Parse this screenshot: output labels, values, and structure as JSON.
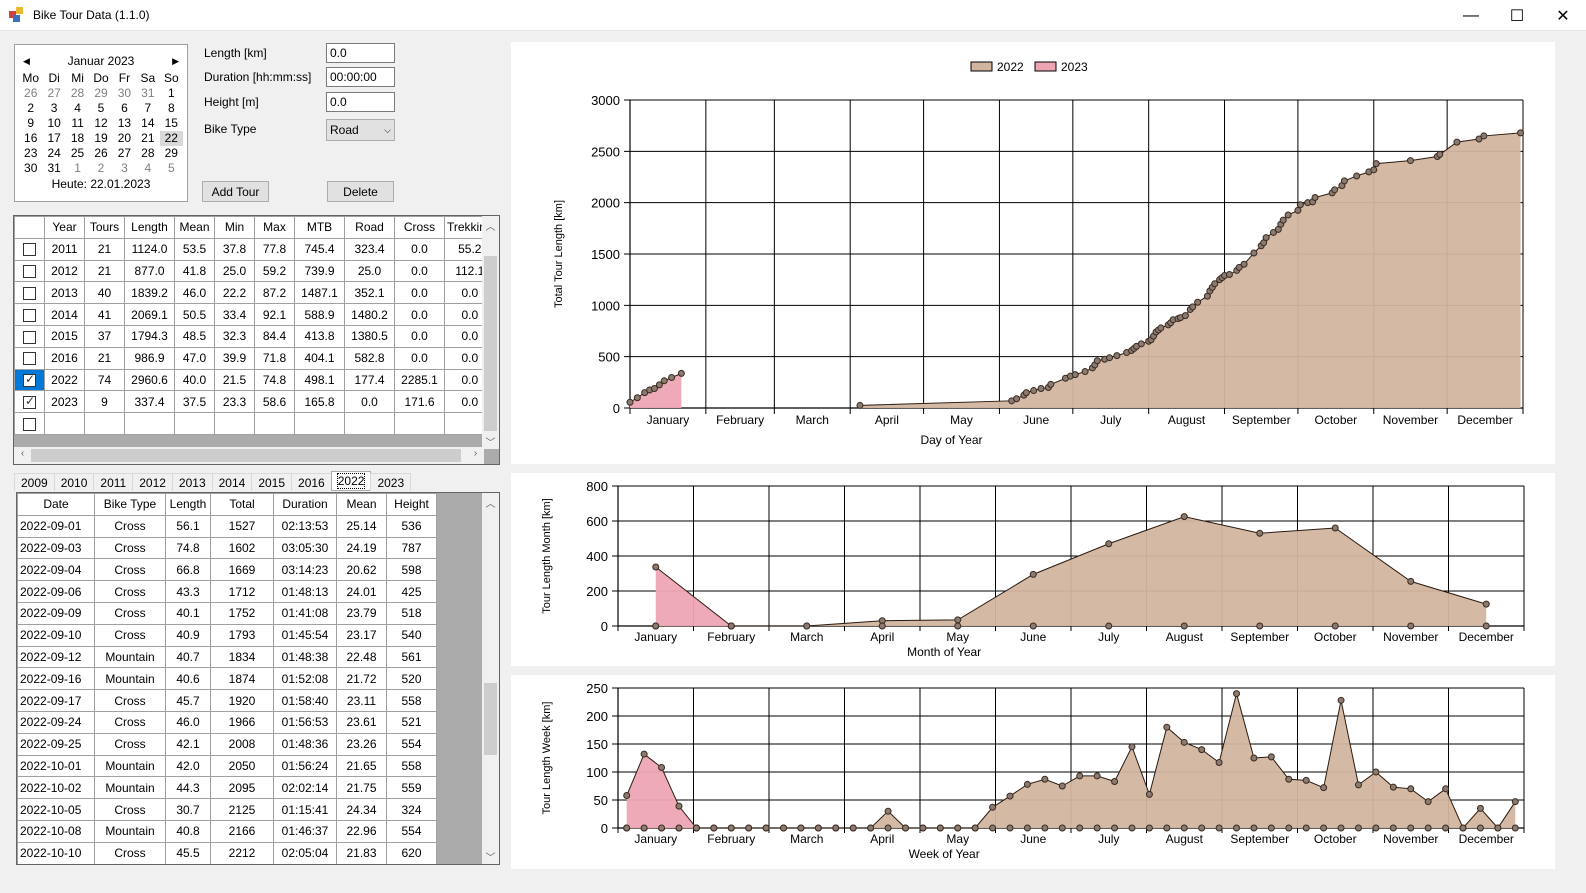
{
  "window": {
    "title": "Bike Tour Data (1.1.0)",
    "controls": {
      "minimize": "—",
      "maximize": "☐",
      "close": "✕"
    }
  },
  "calendar": {
    "month_label": "Januar 2023",
    "prev_arrow": "◀",
    "next_arrow": "▶",
    "weekdays": [
      "Mo",
      "Di",
      "Mi",
      "Do",
      "Fr",
      "Sa",
      "So"
    ],
    "weeks": [
      [
        {
          "d": "26",
          "dim": true
        },
        {
          "d": "27",
          "dim": true
        },
        {
          "d": "28",
          "dim": true
        },
        {
          "d": "29",
          "dim": true
        },
        {
          "d": "30",
          "dim": true
        },
        {
          "d": "31",
          "dim": true
        },
        {
          "d": "1"
        }
      ],
      [
        {
          "d": "2"
        },
        {
          "d": "3"
        },
        {
          "d": "4"
        },
        {
          "d": "5"
        },
        {
          "d": "6"
        },
        {
          "d": "7"
        },
        {
          "d": "8"
        }
      ],
      [
        {
          "d": "9"
        },
        {
          "d": "10"
        },
        {
          "d": "11"
        },
        {
          "d": "12"
        },
        {
          "d": "13"
        },
        {
          "d": "14"
        },
        {
          "d": "15"
        }
      ],
      [
        {
          "d": "16"
        },
        {
          "d": "17"
        },
        {
          "d": "18"
        },
        {
          "d": "19"
        },
        {
          "d": "20"
        },
        {
          "d": "21"
        },
        {
          "d": "22",
          "selected": true
        }
      ],
      [
        {
          "d": "23"
        },
        {
          "d": "24"
        },
        {
          "d": "25"
        },
        {
          "d": "26"
        },
        {
          "d": "27"
        },
        {
          "d": "28"
        },
        {
          "d": "29"
        }
      ],
      [
        {
          "d": "30"
        },
        {
          "d": "31"
        },
        {
          "d": "1",
          "dim": true
        },
        {
          "d": "2",
          "dim": true
        },
        {
          "d": "3",
          "dim": true
        },
        {
          "d": "4",
          "dim": true
        },
        {
          "d": "5",
          "dim": true
        }
      ]
    ],
    "today_label": "Heute: 22.01.2023"
  },
  "form": {
    "length_label": "Length [km]",
    "length_value": "0.0",
    "duration_label": "Duration [hh:mm:ss]",
    "duration_value": "00:00:00",
    "height_label": "Height [m]",
    "height_value": "0.0",
    "bike_type_label": "Bike Type",
    "bike_type_value": "Road",
    "add_tour_button": "Add Tour",
    "delete_button": "Delete"
  },
  "year_summary": {
    "columns": [
      "",
      "Year",
      "Tours",
      "Length",
      "Mean",
      "Min",
      "Max",
      "MTB",
      "Road",
      "Cross",
      "Trekking"
    ],
    "rows": [
      {
        "checked": false,
        "cells": [
          "2011",
          "21",
          "1124.0",
          "53.5",
          "37.8",
          "77.8",
          "745.4",
          "323.4",
          "0.0",
          "55.2"
        ]
      },
      {
        "checked": false,
        "cells": [
          "2012",
          "21",
          "877.0",
          "41.8",
          "25.0",
          "59.2",
          "739.9",
          "25.0",
          "0.0",
          "112.1"
        ]
      },
      {
        "checked": false,
        "cells": [
          "2013",
          "40",
          "1839.2",
          "46.0",
          "22.2",
          "87.2",
          "1487.1",
          "352.1",
          "0.0",
          "0.0"
        ]
      },
      {
        "checked": false,
        "cells": [
          "2014",
          "41",
          "2069.1",
          "50.5",
          "33.4",
          "92.1",
          "588.9",
          "1480.2",
          "0.0",
          "0.0"
        ]
      },
      {
        "checked": false,
        "cells": [
          "2015",
          "37",
          "1794.3",
          "48.5",
          "32.3",
          "84.4",
          "413.8",
          "1380.5",
          "0.0",
          "0.0"
        ]
      },
      {
        "checked": false,
        "cells": [
          "2016",
          "21",
          "986.9",
          "47.0",
          "39.9",
          "71.8",
          "404.1",
          "582.8",
          "0.0",
          "0.0"
        ]
      },
      {
        "checked": true,
        "active": true,
        "cells": [
          "2022",
          "74",
          "2960.6",
          "40.0",
          "21.5",
          "74.8",
          "498.1",
          "177.4",
          "2285.1",
          "0.0"
        ]
      },
      {
        "checked": true,
        "cells": [
          "2023",
          "9",
          "337.4",
          "37.5",
          "23.3",
          "58.6",
          "165.8",
          "0.0",
          "171.6",
          "0.0"
        ]
      },
      {
        "checked": false,
        "cells": [
          "",
          "",
          "",
          "",
          "",
          "",
          "",
          "",
          "",
          ""
        ]
      }
    ]
  },
  "year_tabs": {
    "tabs": [
      "2009",
      "2010",
      "2011",
      "2012",
      "2013",
      "2014",
      "2015",
      "2016",
      "2022",
      "2023"
    ],
    "active": "2022"
  },
  "tours": {
    "columns": [
      "Date",
      "Bike Type",
      "Length",
      "Total",
      "Duration",
      "Mean",
      "Height"
    ],
    "rows": [
      [
        "2022-09-01",
        "Cross",
        "56.1",
        "1527",
        "02:13:53",
        "25.14",
        "536"
      ],
      [
        "2022-09-03",
        "Cross",
        "74.8",
        "1602",
        "03:05:30",
        "24.19",
        "787"
      ],
      [
        "2022-09-04",
        "Cross",
        "66.8",
        "1669",
        "03:14:23",
        "20.62",
        "598"
      ],
      [
        "2022-09-06",
        "Cross",
        "43.3",
        "1712",
        "01:48:13",
        "24.01",
        "425"
      ],
      [
        "2022-09-09",
        "Cross",
        "40.1",
        "1752",
        "01:41:08",
        "23.79",
        "518"
      ],
      [
        "2022-09-10",
        "Cross",
        "40.9",
        "1793",
        "01:45:54",
        "23.17",
        "540"
      ],
      [
        "2022-09-12",
        "Mountain",
        "40.7",
        "1834",
        "01:48:38",
        "22.48",
        "561"
      ],
      [
        "2022-09-16",
        "Mountain",
        "40.6",
        "1874",
        "01:52:08",
        "21.72",
        "520"
      ],
      [
        "2022-09-17",
        "Cross",
        "45.7",
        "1920",
        "01:58:40",
        "23.11",
        "558"
      ],
      [
        "2022-09-24",
        "Cross",
        "46.0",
        "1966",
        "01:56:53",
        "23.61",
        "521"
      ],
      [
        "2022-09-25",
        "Cross",
        "42.1",
        "2008",
        "01:48:36",
        "23.26",
        "554"
      ],
      [
        "2022-10-01",
        "Mountain",
        "42.0",
        "2050",
        "01:56:24",
        "21.65",
        "558"
      ],
      [
        "2022-10-02",
        "Mountain",
        "44.3",
        "2095",
        "02:02:14",
        "21.75",
        "559"
      ],
      [
        "2022-10-05",
        "Cross",
        "30.7",
        "2125",
        "01:15:41",
        "24.34",
        "324"
      ],
      [
        "2022-10-08",
        "Mountain",
        "40.8",
        "2166",
        "01:46:37",
        "22.96",
        "554"
      ],
      [
        "2022-10-10",
        "Cross",
        "45.5",
        "2212",
        "02:05:04",
        "21.83",
        "620"
      ]
    ]
  },
  "colors": {
    "series_2022": "#d2b5a0",
    "series_2023": "#eda5b4",
    "grid": "#000000",
    "selection": "#0078d7"
  },
  "chart_data": [
    {
      "type": "area",
      "title": "",
      "xlabel": "Day of Year",
      "ylabel": "Total Tour Length [km]",
      "ylim": [
        0,
        3000
      ],
      "yticks": [
        0,
        500,
        1000,
        1500,
        2000,
        2500,
        3000
      ],
      "xlim": [
        1,
        366
      ],
      "x_categories": [
        "January",
        "February",
        "March",
        "April",
        "May",
        "June",
        "July",
        "August",
        "September",
        "October",
        "November",
        "December"
      ],
      "legend": [
        "2022",
        "2023"
      ],
      "legend_position": "top-right",
      "grid": true,
      "series": [
        {
          "name": "2022",
          "x": [
            95,
            157,
            159,
            162,
            163,
            166,
            169,
            172,
            173,
            179,
            181,
            183,
            187,
            190,
            191,
            192,
            195,
            197,
            200,
            204,
            206,
            207,
            208,
            210,
            213,
            214,
            215,
            216,
            217,
            218,
            221,
            222,
            223,
            225,
            226,
            228,
            230,
            231,
            233,
            237,
            238,
            239,
            240,
            242,
            243,
            244,
            246,
            249,
            250,
            252,
            256,
            259,
            260,
            261,
            264,
            266,
            267,
            268,
            270,
            274,
            275,
            278,
            280,
            281,
            288,
            289,
            292,
            293,
            298,
            303,
            305,
            306,
            320,
            331,
            332,
            339,
            348,
            350,
            365
          ],
          "y": [
            25,
            70,
            90,
            125,
            150,
            170,
            190,
            200,
            230,
            290,
            310,
            325,
            355,
            390,
            420,
            460,
            475,
            490,
            510,
            540,
            560,
            580,
            600,
            625,
            650,
            665,
            700,
            740,
            760,
            780,
            810,
            830,
            860,
            870,
            880,
            900,
            960,
            985,
            1030,
            1090,
            1140,
            1175,
            1210,
            1250,
            1270,
            1290,
            1300,
            1340,
            1370,
            1400,
            1510,
            1580,
            1610,
            1660,
            1710,
            1740,
            1790,
            1830,
            1880,
            1925,
            1980,
            2000,
            2008,
            2050,
            2095,
            2125,
            2166,
            2212,
            2260,
            2300,
            2320,
            2380,
            2410,
            2450,
            2470,
            2590,
            2620,
            2650,
            2680
          ]
        },
        {
          "name": "2023",
          "x": [
            1,
            4,
            7,
            9,
            11,
            13,
            15,
            18,
            22
          ],
          "y": [
            56,
            100,
            150,
            175,
            190,
            225,
            265,
            297,
            337
          ]
        }
      ]
    },
    {
      "type": "area",
      "xlabel": "Month  of Year",
      "ylabel": "Tour Length Month [km]",
      "ylim": [
        0,
        800
      ],
      "yticks": [
        0,
        200,
        400,
        600,
        800
      ],
      "categories": [
        "January",
        "February",
        "March",
        "April",
        "May",
        "June",
        "July",
        "August",
        "September",
        "October",
        "November",
        "December"
      ],
      "grid": true,
      "series": [
        {
          "name": "2022",
          "values": [
            0,
            0,
            0,
            30,
            35,
            295,
            470,
            625,
            530,
            560,
            255,
            125
          ]
        },
        {
          "name": "2023",
          "values": [
            337,
            0,
            null,
            null,
            null,
            null,
            null,
            null,
            null,
            null,
            null,
            null
          ]
        }
      ]
    },
    {
      "type": "area",
      "xlabel": "Week of Year",
      "ylabel": "Tour Length Week [km]",
      "ylim": [
        0,
        250
      ],
      "yticks": [
        0,
        50,
        100,
        150,
        200,
        250
      ],
      "x_categories": [
        "January",
        "February",
        "March",
        "April",
        "May",
        "June",
        "July",
        "August",
        "September",
        "October",
        "November",
        "December"
      ],
      "grid": true,
      "series": [
        {
          "name": "2022",
          "weeks": [
            1,
            2,
            3,
            4,
            5,
            6,
            7,
            8,
            9,
            10,
            11,
            12,
            13,
            14,
            15,
            16,
            17,
            18,
            19,
            20,
            21,
            22,
            23,
            24,
            25,
            26,
            27,
            28,
            29,
            30,
            31,
            32,
            33,
            34,
            35,
            36,
            37,
            38,
            39,
            40,
            41,
            42,
            43,
            44,
            45,
            46,
            47,
            48,
            49,
            50,
            51,
            52
          ],
          "values": [
            0,
            0,
            0,
            0,
            0,
            0,
            0,
            0,
            0,
            0,
            0,
            0,
            0,
            0,
            0,
            30,
            0,
            0,
            0,
            0,
            0,
            37,
            57,
            78,
            87,
            75,
            93,
            93,
            83,
            145,
            60,
            180,
            153,
            140,
            117,
            240,
            125,
            127,
            87,
            85,
            72,
            228,
            77,
            100,
            73,
            70,
            47,
            70,
            0,
            35,
            0,
            47
          ]
        },
        {
          "name": "2023",
          "weeks": [
            1,
            2,
            3,
            4,
            5
          ],
          "values": [
            58,
            132,
            108,
            39,
            0
          ]
        }
      ]
    }
  ]
}
